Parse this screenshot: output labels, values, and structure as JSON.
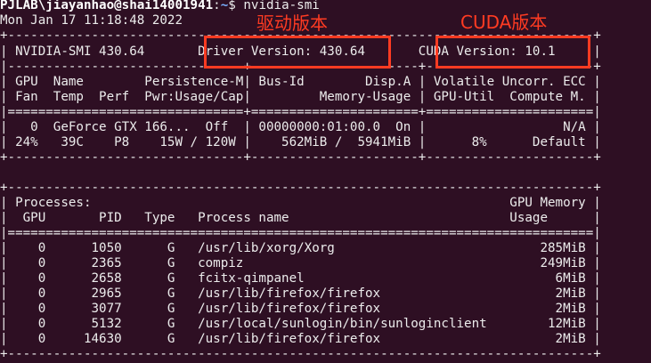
{
  "prompt": {
    "user_host": "PJLAB\\jiayanhao@shai14001941",
    "sep": ":",
    "path": "~",
    "dollar": "$ ",
    "command": "nvidia-smi"
  },
  "datetime": "Mon Jan 17 11:18:48 2022",
  "lines": [
    "+-----------------------------------------------------------------------------+",
    "| NVIDIA-SMI 430.64       Driver Version: 430.64       CUDA Version: 10.1     |",
    "|-------------------------------+----------------------+----------------------+",
    "| GPU  Name        Persistence-M| Bus-Id        Disp.A | Volatile Uncorr. ECC |",
    "| Fan  Temp  Perf  Pwr:Usage/Cap|         Memory-Usage | GPU-Util  Compute M. |",
    "|===============================+======================+======================|",
    "|   0  GeForce GTX 166...  Off  | 00000000:01:00.0  On |                  N/A |",
    "| 24%   39C    P8    15W / 120W |    562MiB /  5941MiB |      8%      Default |",
    "+-------------------------------+----------------------+----------------------+",
    "",
    "+-----------------------------------------------------------------------------+",
    "| Processes:                                                       GPU Memory |",
    "|  GPU       PID   Type   Process name                             Usage      |",
    "|=============================================================================|",
    "|    0      1050      G   /usr/lib/xorg/Xorg                           285MiB |",
    "|    0      2365      G   compiz                                       249MiB |",
    "|    0      2658      G   fcitx-qimpanel                                 6MiB |",
    "|    0      2965      G   /usr/lib/firefox/firefox                       2MiB |",
    "|    0      3077      G   /usr/lib/firefox/firefox                       2MiB |",
    "|    0      5132      G   /usr/local/sunlogin/bin/sunloginclient        12MiB |",
    "|    0     14630      G   /usr/lib/firefox/firefox                       2MiB |",
    "+-----------------------------------------------------------------------------+"
  ],
  "annotations": {
    "driver_label": "驱动版本",
    "cuda_label": "CUDA版本"
  },
  "colors": {
    "background": "#2e0f23",
    "text": "#ececec",
    "prompt_user": "#ffffff",
    "prompt_path": "#7ab0ff",
    "annotation": "#ff3b22"
  }
}
